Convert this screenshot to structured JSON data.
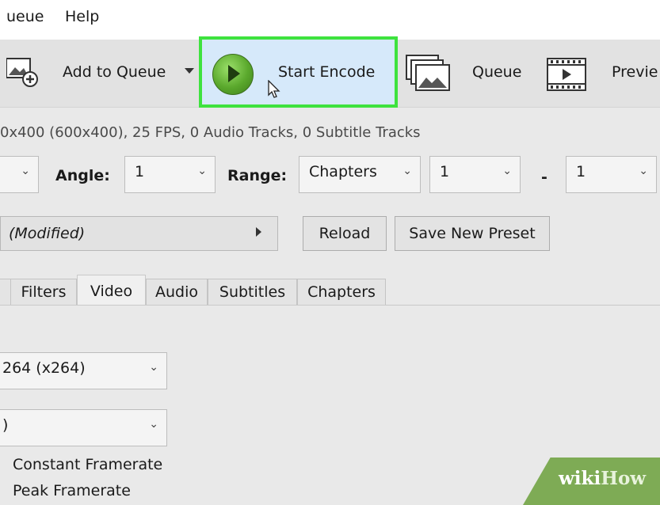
{
  "menubar": {
    "items": [
      "ueue",
      "Help"
    ]
  },
  "toolbar": {
    "add_to_queue": "Add to Queue",
    "start_encode": "Start Encode",
    "queue": "Queue",
    "preview": "Previe"
  },
  "source_info": "0x400 (600x400), 25 FPS, 0 Audio Tracks, 0 Subtitle Tracks",
  "title_row": {
    "angle_label": "Angle:",
    "angle_value": "1",
    "range_label": "Range:",
    "range_type": "Chapters",
    "range_start": "1",
    "range_sep": "-",
    "range_end": "1"
  },
  "preset_row": {
    "preset_name": "(Modified)",
    "reload": "Reload",
    "save_new_preset": "Save New Preset"
  },
  "tabs": [
    "Filters",
    "Video",
    "Audio",
    "Subtitles",
    "Chapters"
  ],
  "active_tab": "Video",
  "video": {
    "encoder": "264 (x264)",
    "framerate_value": ")",
    "constant_framerate": "Constant Framerate",
    "peak_framerate": "Peak Framerate"
  },
  "watermark": {
    "wiki": "wiki",
    "how": "How"
  }
}
